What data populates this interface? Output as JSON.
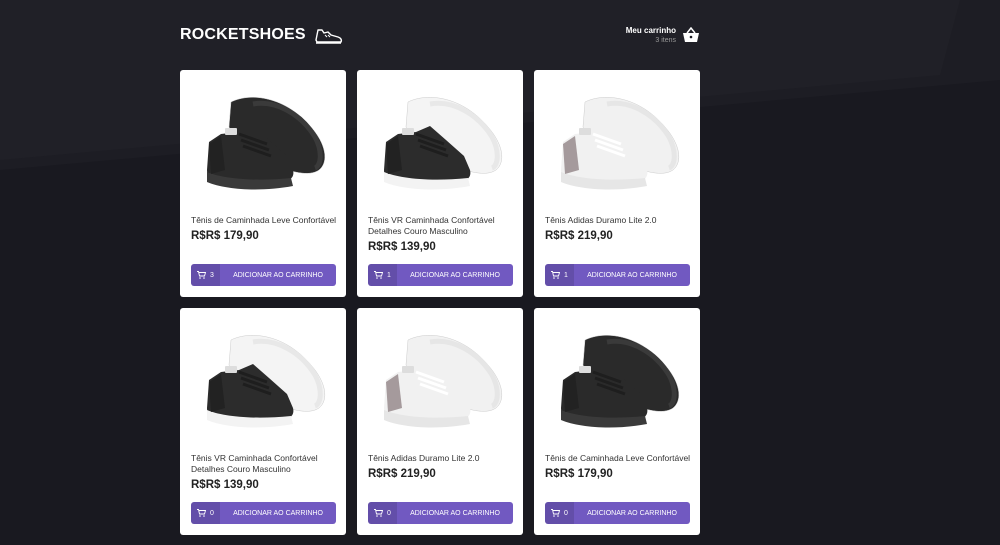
{
  "header": {
    "logo_text": "ROCKETSHOES",
    "cart_title": "Meu carrinho",
    "cart_count": "3 itens"
  },
  "colors": {
    "background": "#191920",
    "accent": "#7159c1",
    "card": "#ffffff"
  },
  "products": [
    {
      "title": "Tênis de Caminhada Leve Confortável",
      "price": "R$R$ 179,90",
      "qty": "3",
      "button": "ADICIONAR AO CARRINHO",
      "shoe": "black"
    },
    {
      "title": "Tênis VR Caminhada Confortável Detalhes Couro Masculino",
      "price": "R$R$ 139,90",
      "qty": "1",
      "button": "ADICIONAR AO CARRINHO",
      "shoe": "black-white"
    },
    {
      "title": "Tênis Adidas Duramo Lite 2.0",
      "price": "R$R$ 219,90",
      "qty": "1",
      "button": "ADICIONAR AO CARRINHO",
      "shoe": "white"
    },
    {
      "title": "Tênis VR Caminhada Confortável Detalhes Couro Masculino",
      "price": "R$R$ 139,90",
      "qty": "0",
      "button": "ADICIONAR AO CARRINHO",
      "shoe": "black-white"
    },
    {
      "title": "Tênis Adidas Duramo Lite 2.0",
      "price": "R$R$ 219,90",
      "qty": "0",
      "button": "ADICIONAR AO CARRINHO",
      "shoe": "white"
    },
    {
      "title": "Tênis de Caminhada Leve Confortável",
      "price": "R$R$ 179,90",
      "qty": "0",
      "button": "ADICIONAR AO CARRINHO",
      "shoe": "black"
    }
  ]
}
